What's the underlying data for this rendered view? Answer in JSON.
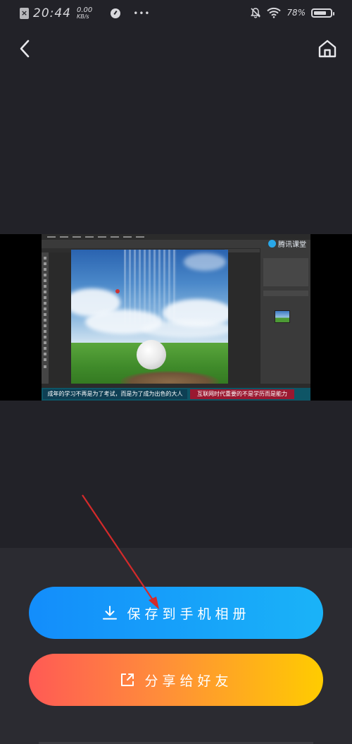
{
  "status_bar": {
    "time": "20:44",
    "net_speed_value": "0.00",
    "net_speed_unit": "KB/s",
    "battery_percent": "78%",
    "battery_level": 0.78,
    "icons": [
      "close-box-icon",
      "speedometer-icon",
      "more-dots-icon",
      "mute-bell-icon",
      "wifi-icon",
      "battery-icon"
    ]
  },
  "nav": {
    "back_icon": "chevron-left-icon",
    "home_icon": "home-icon"
  },
  "preview": {
    "watermark": "腾讯课堂",
    "subtitle_left": "成年的学习不再是为了考试，而是为了成为出色的大人",
    "subtitle_right": "互联网时代重要的不是学历而是能力"
  },
  "actions": {
    "save_label": "保存到手机相册",
    "save_icon": "download-icon",
    "share_label": "分享给好友",
    "share_icon": "share-icon"
  },
  "colors": {
    "background": "#222228",
    "panel": "#2b2b31",
    "save_gradient_start": "#138dfb",
    "save_gradient_end": "#1ab3f8",
    "share_gradient_start": "#ff5a55",
    "share_gradient_end": "#ffcc00",
    "annotation_arrow": "#d42a2a"
  }
}
